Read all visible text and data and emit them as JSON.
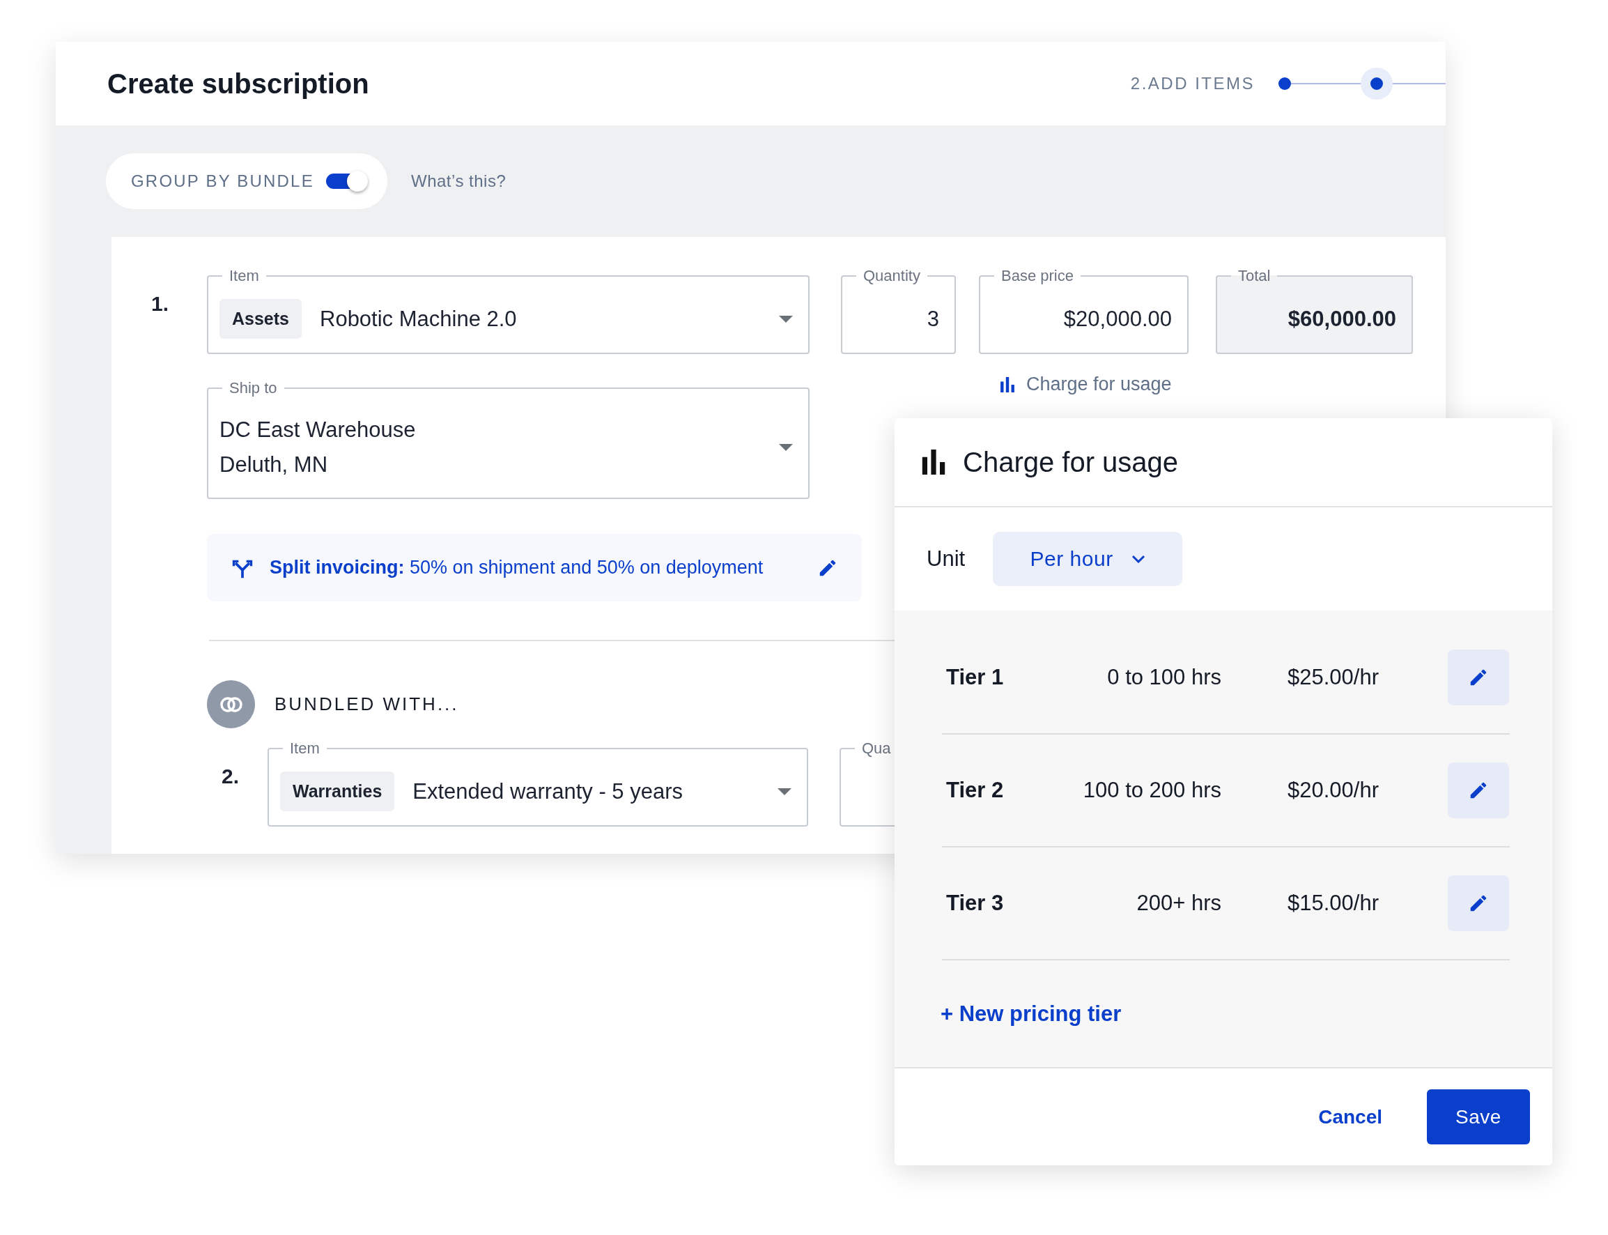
{
  "header": {
    "title": "Create subscription",
    "step_label": "2.ADD ITEMS",
    "steps": [
      {
        "selected": false
      },
      {
        "selected": true
      }
    ]
  },
  "group_toggle": {
    "label": "GROUP BY BUNDLE",
    "on": true
  },
  "help_link": "What’s this?",
  "item_1": {
    "number": "1.",
    "item_label": "Item",
    "category": "Assets",
    "item": "Robotic Machine 2.0",
    "quantity_label": "Quantity",
    "quantity": "3",
    "base_price_label": "Base price",
    "base_price": "$20,000.00",
    "total_label": "Total",
    "total": "$60,000.00",
    "usage_link": "Charge for usage",
    "ship_to_label": "Ship to",
    "ship_to": [
      "DC East Warehouse",
      "Deluth, MN"
    ],
    "split_invoicing": "**Split invoicing:** 50% on shipment and 50% on deployment"
  },
  "bundle": {
    "label": "BUNDLED WITH...",
    "item": {
      "number": "2.",
      "item_label": "Item",
      "category": "Warranties",
      "item": "Extended warranty - 5 years",
      "quantity_label": "Qua"
    }
  },
  "usage_panel": {
    "title": "Charge for usage",
    "unit_label": "Unit",
    "unit": "Per hour",
    "tiers": [
      {
        "name": "Tier 1",
        "range": "0 to 100 hrs",
        "price": "$25.00/hr"
      },
      {
        "name": "Tier 2",
        "range": "100 to 200 hrs",
        "price": "$20.00/hr"
      },
      {
        "name": "Tier 3",
        "range": "200+ hrs",
        "price": "$15.00/hr"
      }
    ],
    "new_tier": "+ New pricing tier",
    "cancel": "Cancel",
    "save": "Save"
  }
}
